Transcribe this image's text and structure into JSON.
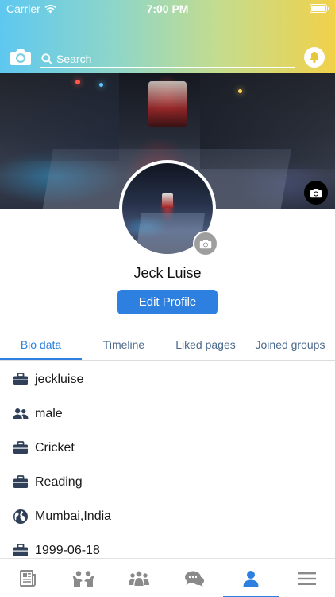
{
  "status_bar": {
    "carrier": "Carrier",
    "time": "7:00 PM"
  },
  "header": {
    "search_placeholder": "Search",
    "icons": [
      "camera-icon",
      "search-icon",
      "bell-icon"
    ]
  },
  "profile": {
    "name": "Jeck Luise",
    "edit_button_label": "Edit Profile"
  },
  "tabs": [
    {
      "label": "Bio data",
      "active": true
    },
    {
      "label": "Timeline",
      "active": false
    },
    {
      "label": "Liked pages",
      "active": false
    },
    {
      "label": "Joined groups",
      "active": false
    }
  ],
  "bio": [
    {
      "icon": "briefcase-icon",
      "value": "jeckluise"
    },
    {
      "icon": "people-icon",
      "value": "male"
    },
    {
      "icon": "briefcase-icon",
      "value": "Cricket"
    },
    {
      "icon": "briefcase-icon",
      "value": "Reading"
    },
    {
      "icon": "globe-icon",
      "value": "Mumbai,India"
    },
    {
      "icon": "briefcase-icon",
      "value": "1999-06-18"
    }
  ],
  "bottom_nav": [
    {
      "icon": "news-feed-icon",
      "active": false
    },
    {
      "icon": "friends-icon",
      "active": false
    },
    {
      "icon": "groups-icon",
      "active": false
    },
    {
      "icon": "chat-icon",
      "active": false
    },
    {
      "icon": "profile-icon",
      "active": true
    },
    {
      "icon": "menu-icon",
      "active": false
    }
  ],
  "colors": {
    "accent": "#2d7fe0",
    "tab_text": "#4c6a8c",
    "icon_dark": "#2f4058",
    "nav_icon": "#8a8a8a",
    "header_gradient": [
      "#5ec8f0",
      "#f1d14a"
    ]
  }
}
